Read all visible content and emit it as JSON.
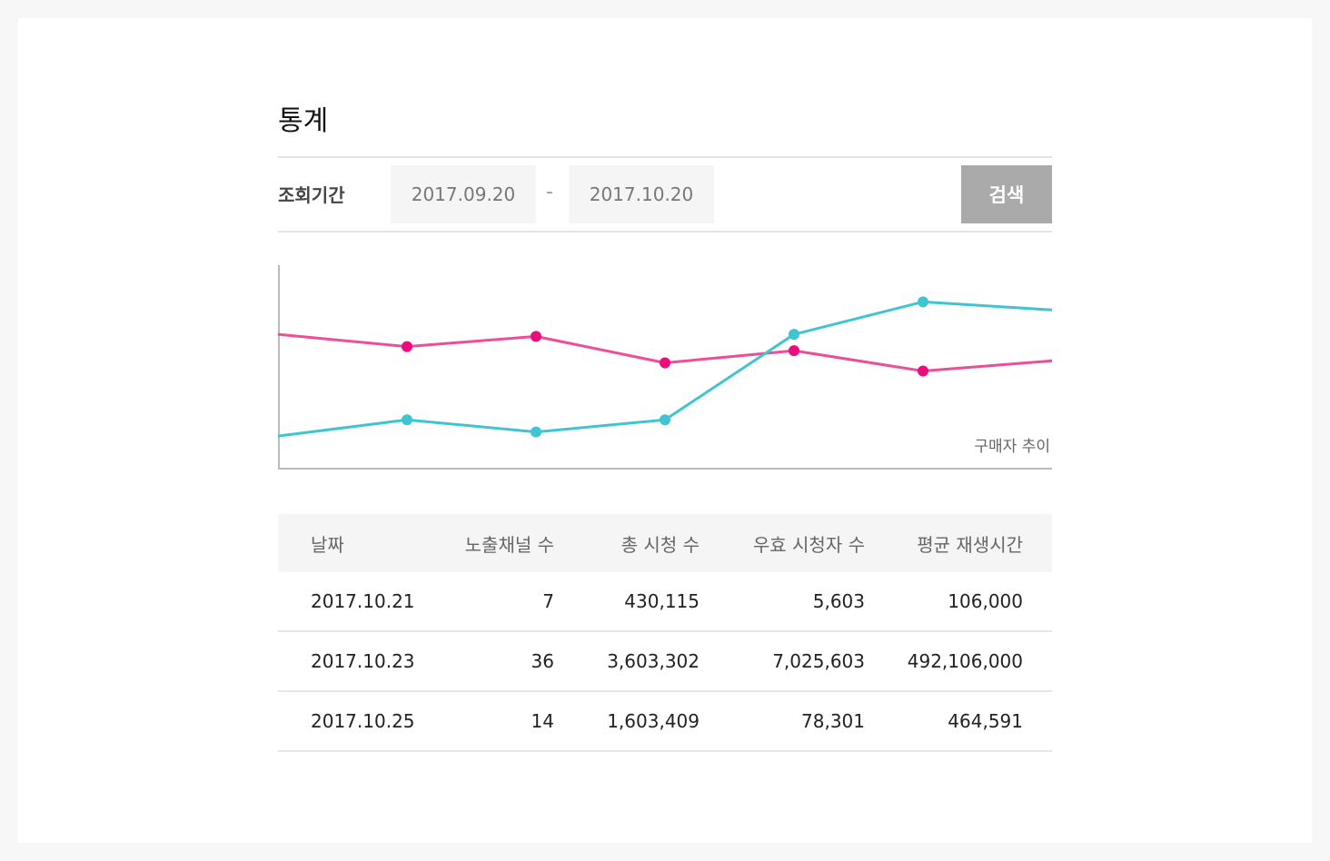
{
  "page": {
    "title": "통계"
  },
  "filter": {
    "label": "조회기간",
    "start_date": "2017.09.20",
    "separator": "-",
    "end_date": "2017.10.20",
    "search_label": "검색"
  },
  "chart": {
    "label": "구매자 추이",
    "colors": {
      "pink_line": "#ee4d98",
      "pink_marker": "#ec0c7d",
      "cyan_line": "#3fc4d3",
      "cyan_marker": "#3fc4d3",
      "axis": "#bbbbbb"
    }
  },
  "chart_data": {
    "type": "line",
    "x": [
      0,
      1,
      2,
      3,
      4,
      5,
      6
    ],
    "series": [
      {
        "color": "#ee4d98",
        "values": [
          6.6,
          6.0,
          6.5,
          5.2,
          5.8,
          4.8,
          5.3
        ],
        "markers": [
          false,
          true,
          true,
          true,
          true,
          true,
          false
        ]
      },
      {
        "color": "#3fc4d3",
        "values": [
          1.6,
          2.4,
          1.8,
          2.4,
          6.6,
          8.2,
          7.8
        ],
        "markers": [
          false,
          true,
          true,
          true,
          true,
          true,
          false
        ]
      }
    ],
    "ylim": [
      0,
      10
    ],
    "grid": false
  },
  "table": {
    "headers": [
      "날짜",
      "노출채널 수",
      "총 시청 수",
      "우효 시청자 수",
      "평균 재생시간"
    ],
    "rows": [
      [
        "2017.10.21",
        "7",
        "430,115",
        "5,603",
        "106,000"
      ],
      [
        "2017.10.23",
        "36",
        "3,603,302",
        "7,025,603",
        "492,106,000"
      ],
      [
        "2017.10.25",
        "14",
        "1,603,409",
        "78,301",
        "464,591"
      ]
    ]
  }
}
